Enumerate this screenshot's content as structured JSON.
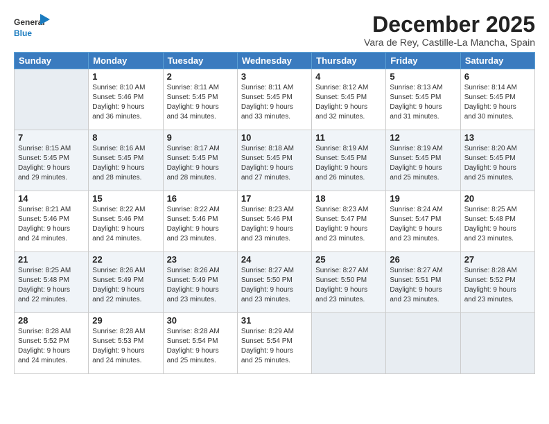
{
  "header": {
    "logo_general": "General",
    "logo_blue": "Blue",
    "month_title": "December 2025",
    "location": "Vara de Rey, Castille-La Mancha, Spain"
  },
  "weekdays": [
    "Sunday",
    "Monday",
    "Tuesday",
    "Wednesday",
    "Thursday",
    "Friday",
    "Saturday"
  ],
  "weeks": [
    [
      {
        "day": "",
        "info": ""
      },
      {
        "day": "1",
        "info": "Sunrise: 8:10 AM\nSunset: 5:46 PM\nDaylight: 9 hours\nand 36 minutes."
      },
      {
        "day": "2",
        "info": "Sunrise: 8:11 AM\nSunset: 5:45 PM\nDaylight: 9 hours\nand 34 minutes."
      },
      {
        "day": "3",
        "info": "Sunrise: 8:11 AM\nSunset: 5:45 PM\nDaylight: 9 hours\nand 33 minutes."
      },
      {
        "day": "4",
        "info": "Sunrise: 8:12 AM\nSunset: 5:45 PM\nDaylight: 9 hours\nand 32 minutes."
      },
      {
        "day": "5",
        "info": "Sunrise: 8:13 AM\nSunset: 5:45 PM\nDaylight: 9 hours\nand 31 minutes."
      },
      {
        "day": "6",
        "info": "Sunrise: 8:14 AM\nSunset: 5:45 PM\nDaylight: 9 hours\nand 30 minutes."
      }
    ],
    [
      {
        "day": "7",
        "info": "Sunrise: 8:15 AM\nSunset: 5:45 PM\nDaylight: 9 hours\nand 29 minutes."
      },
      {
        "day": "8",
        "info": "Sunrise: 8:16 AM\nSunset: 5:45 PM\nDaylight: 9 hours\nand 28 minutes."
      },
      {
        "day": "9",
        "info": "Sunrise: 8:17 AM\nSunset: 5:45 PM\nDaylight: 9 hours\nand 28 minutes."
      },
      {
        "day": "10",
        "info": "Sunrise: 8:18 AM\nSunset: 5:45 PM\nDaylight: 9 hours\nand 27 minutes."
      },
      {
        "day": "11",
        "info": "Sunrise: 8:19 AM\nSunset: 5:45 PM\nDaylight: 9 hours\nand 26 minutes."
      },
      {
        "day": "12",
        "info": "Sunrise: 8:19 AM\nSunset: 5:45 PM\nDaylight: 9 hours\nand 25 minutes."
      },
      {
        "day": "13",
        "info": "Sunrise: 8:20 AM\nSunset: 5:45 PM\nDaylight: 9 hours\nand 25 minutes."
      }
    ],
    [
      {
        "day": "14",
        "info": "Sunrise: 8:21 AM\nSunset: 5:46 PM\nDaylight: 9 hours\nand 24 minutes."
      },
      {
        "day": "15",
        "info": "Sunrise: 8:22 AM\nSunset: 5:46 PM\nDaylight: 9 hours\nand 24 minutes."
      },
      {
        "day": "16",
        "info": "Sunrise: 8:22 AM\nSunset: 5:46 PM\nDaylight: 9 hours\nand 23 minutes."
      },
      {
        "day": "17",
        "info": "Sunrise: 8:23 AM\nSunset: 5:46 PM\nDaylight: 9 hours\nand 23 minutes."
      },
      {
        "day": "18",
        "info": "Sunrise: 8:23 AM\nSunset: 5:47 PM\nDaylight: 9 hours\nand 23 minutes."
      },
      {
        "day": "19",
        "info": "Sunrise: 8:24 AM\nSunset: 5:47 PM\nDaylight: 9 hours\nand 23 minutes."
      },
      {
        "day": "20",
        "info": "Sunrise: 8:25 AM\nSunset: 5:48 PM\nDaylight: 9 hours\nand 23 minutes."
      }
    ],
    [
      {
        "day": "21",
        "info": "Sunrise: 8:25 AM\nSunset: 5:48 PM\nDaylight: 9 hours\nand 22 minutes."
      },
      {
        "day": "22",
        "info": "Sunrise: 8:26 AM\nSunset: 5:49 PM\nDaylight: 9 hours\nand 22 minutes."
      },
      {
        "day": "23",
        "info": "Sunrise: 8:26 AM\nSunset: 5:49 PM\nDaylight: 9 hours\nand 23 minutes."
      },
      {
        "day": "24",
        "info": "Sunrise: 8:27 AM\nSunset: 5:50 PM\nDaylight: 9 hours\nand 23 minutes."
      },
      {
        "day": "25",
        "info": "Sunrise: 8:27 AM\nSunset: 5:50 PM\nDaylight: 9 hours\nand 23 minutes."
      },
      {
        "day": "26",
        "info": "Sunrise: 8:27 AM\nSunset: 5:51 PM\nDaylight: 9 hours\nand 23 minutes."
      },
      {
        "day": "27",
        "info": "Sunrise: 8:28 AM\nSunset: 5:52 PM\nDaylight: 9 hours\nand 23 minutes."
      }
    ],
    [
      {
        "day": "28",
        "info": "Sunrise: 8:28 AM\nSunset: 5:52 PM\nDaylight: 9 hours\nand 24 minutes."
      },
      {
        "day": "29",
        "info": "Sunrise: 8:28 AM\nSunset: 5:53 PM\nDaylight: 9 hours\nand 24 minutes."
      },
      {
        "day": "30",
        "info": "Sunrise: 8:28 AM\nSunset: 5:54 PM\nDaylight: 9 hours\nand 25 minutes."
      },
      {
        "day": "31",
        "info": "Sunrise: 8:29 AM\nSunset: 5:54 PM\nDaylight: 9 hours\nand 25 minutes."
      },
      {
        "day": "",
        "info": ""
      },
      {
        "day": "",
        "info": ""
      },
      {
        "day": "",
        "info": ""
      }
    ]
  ]
}
